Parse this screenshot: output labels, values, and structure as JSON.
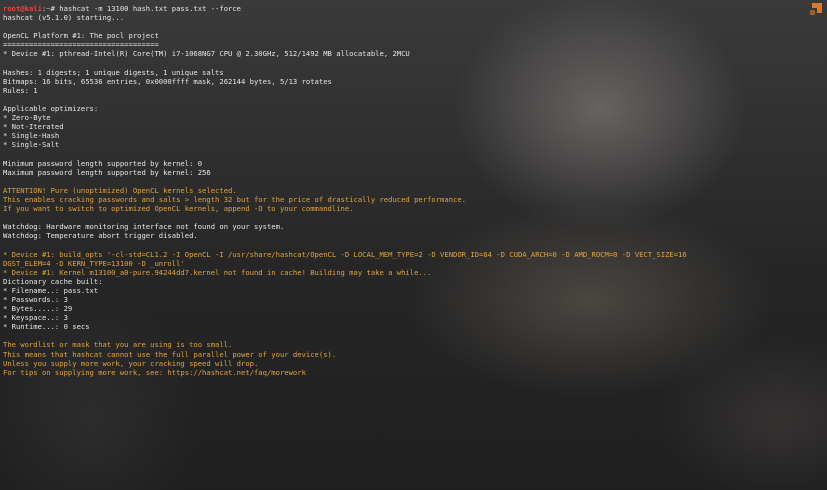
{
  "prompt": {
    "user_host": "root@kali",
    "separator": ":",
    "path": "~",
    "symbol": "# ",
    "command": "hashcat -m 13100 hash.txt pass.txt --force"
  },
  "lines": [
    {
      "text": "hashcat (v5.1.0) starting...",
      "type": "normal"
    },
    {
      "text": "",
      "type": "normal"
    },
    {
      "text": "OpenCL Platform #1: The pocl project",
      "type": "normal"
    },
    {
      "text": "====================================",
      "type": "normal"
    },
    {
      "text": "* Device #1: pthread-Intel(R) Core(TM) i7-1068NG7 CPU @ 2.30GHz, 512/1492 MB allocatable, 2MCU",
      "type": "normal"
    },
    {
      "text": "",
      "type": "normal"
    },
    {
      "text": "Hashes: 1 digests; 1 unique digests, 1 unique salts",
      "type": "normal"
    },
    {
      "text": "Bitmaps: 16 bits, 65536 entries, 0x0000ffff mask, 262144 bytes, 5/13 rotates",
      "type": "normal"
    },
    {
      "text": "Rules: 1",
      "type": "normal"
    },
    {
      "text": "",
      "type": "normal"
    },
    {
      "text": "Applicable optimizers:",
      "type": "normal"
    },
    {
      "text": "* Zero-Byte",
      "type": "normal"
    },
    {
      "text": "* Not-Iterated",
      "type": "normal"
    },
    {
      "text": "* Single-Hash",
      "type": "normal"
    },
    {
      "text": "* Single-Salt",
      "type": "normal"
    },
    {
      "text": "",
      "type": "normal"
    },
    {
      "text": "Minimum password length supported by kernel: 0",
      "type": "normal"
    },
    {
      "text": "Maximum password length supported by kernel: 256",
      "type": "normal"
    },
    {
      "text": "",
      "type": "normal"
    },
    {
      "text": "ATTENTION! Pure (unoptimized) OpenCL kernels selected.",
      "type": "warn"
    },
    {
      "text": "This enables cracking passwords and salts > length 32 but for the price of drastically reduced performance.",
      "type": "warn"
    },
    {
      "text": "If you want to switch to optimized OpenCL kernels, append -O to your commandline.",
      "type": "warn"
    },
    {
      "text": "",
      "type": "normal"
    },
    {
      "text": "Watchdog: Hardware monitoring interface not found on your system.",
      "type": "normal"
    },
    {
      "text": "Watchdog: Temperature abort trigger disabled.",
      "type": "normal"
    },
    {
      "text": "",
      "type": "normal"
    },
    {
      "text": "* Device #1: build_opts '-cl-std=CL1.2 -I OpenCL -I /usr/share/hashcat/OpenCL -D LOCAL_MEM_TYPE=2 -D VENDOR_ID=64 -D CUDA_ARCH=0 -D AMD_ROCM=0 -D VECT_SIZE=16",
      "type": "warn"
    },
    {
      "text": "DGST_ELEM=4 -D KERN_TYPE=13100 -D _unroll'",
      "type": "warn"
    },
    {
      "text": "* Device #1: Kernel m13100_a0-pure.94244dd7.kernel not found in cache! Building may take a while...",
      "type": "warn"
    },
    {
      "text": "Dictionary cache built:",
      "type": "normal"
    },
    {
      "text": "* Filename..: pass.txt",
      "type": "normal"
    },
    {
      "text": "* Passwords.: 3",
      "type": "normal"
    },
    {
      "text": "* Bytes.....: 29",
      "type": "normal"
    },
    {
      "text": "* Keyspace..: 3",
      "type": "normal"
    },
    {
      "text": "* Runtime...: 0 secs",
      "type": "normal"
    },
    {
      "text": "",
      "type": "normal"
    },
    {
      "text": "The wordlist or mask that you are using is too small.",
      "type": "warn"
    },
    {
      "text": "This means that hashcat cannot use the full parallel power of your device(s).",
      "type": "warn"
    },
    {
      "text": "Unless you supply more work, your cracking speed will drop.",
      "type": "warn"
    },
    {
      "text": "For tips on supplying more work, see: https://hashcat.net/faq/morework",
      "type": "warn"
    }
  ],
  "colors": {
    "text": "#e6e6e6",
    "warning": "#e1a43a",
    "prompt_user": "#ff3b3b",
    "prompt_path": "#8ab4ff",
    "corner_logo": "#e0762b"
  },
  "icons": {
    "corner": "brand-logo-icon"
  }
}
